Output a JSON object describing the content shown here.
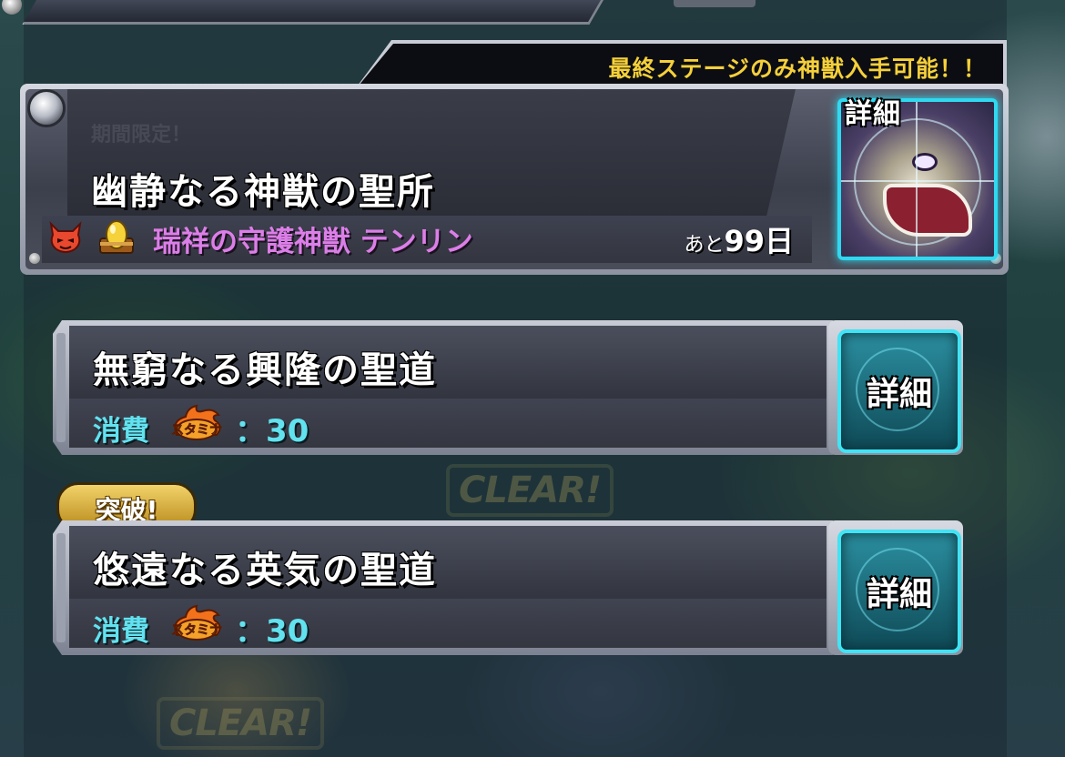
{
  "featured": {
    "notice": "最終ステージのみ神獣入手可能！！",
    "limited_label": "期間限定！",
    "title": "幽静なる神獣の聖所",
    "boss_name": "瑞祥の守護神獣 テンリン",
    "days_prefix": "あと",
    "days_value": "99日",
    "detail_label": "詳細"
  },
  "quests": [
    {
      "title": "無窮なる興隆の聖道",
      "cost_label": "消費",
      "stamina_icon_text": "スタミナ",
      "cost_value": "：30",
      "detail_label": "詳細",
      "badge": ""
    },
    {
      "title": "悠遠なる英気の聖道",
      "cost_label": "消費",
      "stamina_icon_text": "スタミナ",
      "cost_value": "：30",
      "detail_label": "詳細",
      "badge": "突破!"
    }
  ],
  "background": {
    "clear_stamp_1": "CLEAR!",
    "clear_stamp_2": "CLEAR!"
  },
  "colors": {
    "notice_text": "#f5d03a",
    "boss_name": "#dc7ee8",
    "cost_text": "#62e2ef",
    "detail_border": "#40e4f5",
    "badge_gold": "#f2d36a"
  },
  "icons": [
    "devil-element-icon",
    "golden-egg-icon",
    "stamina-icon",
    "crosshair-icon"
  ]
}
